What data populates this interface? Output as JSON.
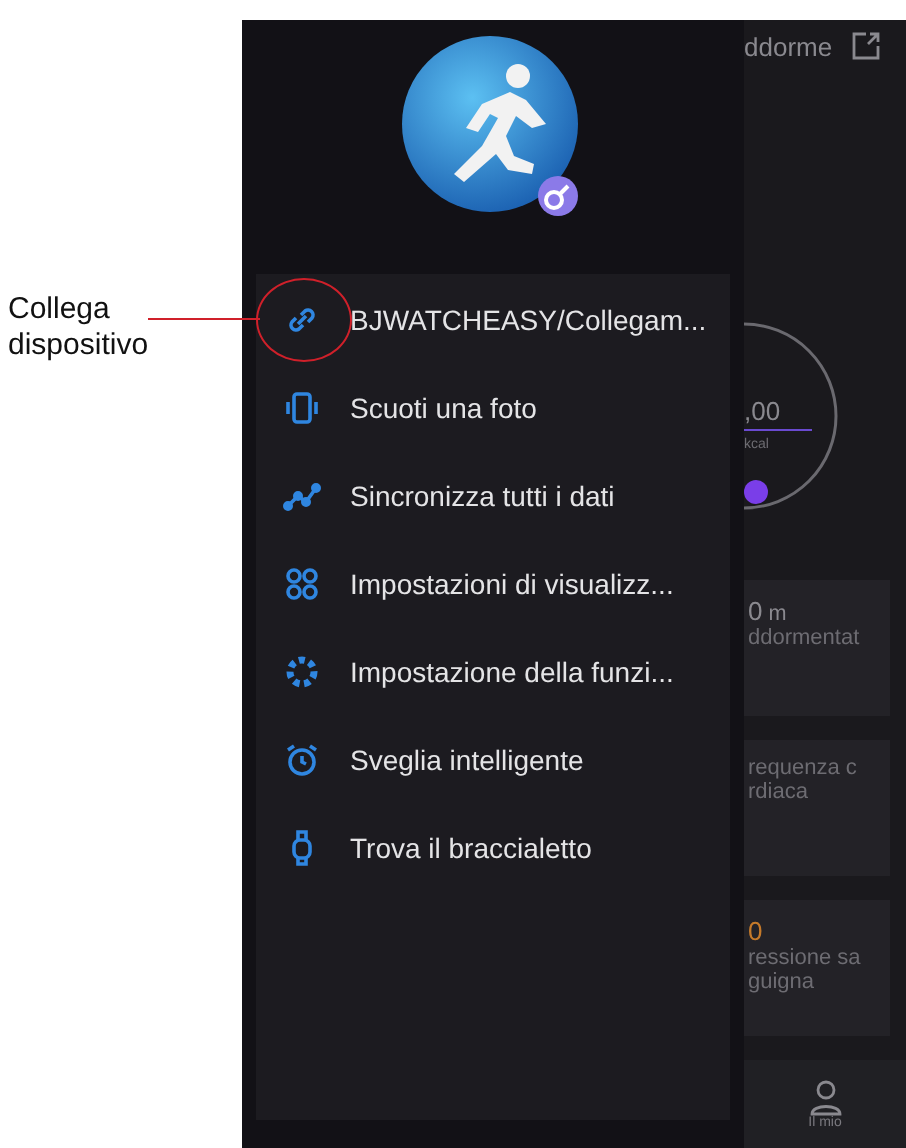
{
  "annotation": {
    "label": "Collega dispositivo"
  },
  "drawer": {
    "menu": [
      {
        "kind": "link",
        "label": "BJWATCHEASY/Collegam...",
        "highlighted": true
      },
      {
        "kind": "phone",
        "label": "Scuoti una foto",
        "highlighted": false
      },
      {
        "kind": "sync",
        "label": "Sincronizza tutti i dati",
        "highlighted": false
      },
      {
        "kind": "grid",
        "label": "Impostazioni di visualizz...",
        "highlighted": false
      },
      {
        "kind": "gear",
        "label": "Impostazione della funzi...",
        "highlighted": false
      },
      {
        "kind": "alarm",
        "label": "Sveglia intelligente",
        "highlighted": false
      },
      {
        "kind": "watch",
        "label": "Trova il braccialetto",
        "highlighted": false
      }
    ]
  },
  "background": {
    "header_title": "ddorme",
    "ring": {
      "value": ",00",
      "unit": "kcal"
    },
    "cards": [
      {
        "value": "0",
        "unit": "m",
        "lines": [
          "ddormentat"
        ]
      },
      {
        "lines": [
          "requenza c",
          "rdiaca"
        ]
      },
      {
        "value": "0",
        "lines": [
          "ressione sa",
          "guigna"
        ]
      }
    ],
    "tab": {
      "label": "Il mio"
    }
  }
}
